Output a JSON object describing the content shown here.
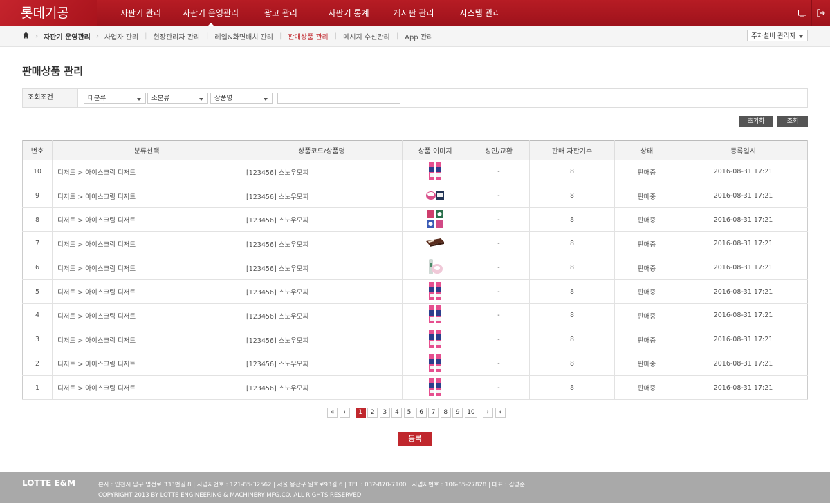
{
  "brand": "롯데기공",
  "nav": [
    "자판기 관리",
    "자판기 운영관리",
    "광고 관리",
    "자판기 통계",
    "게시판 관리",
    "시스템 관리"
  ],
  "breadcrumb": {
    "section": "자판기 운영관리",
    "items": [
      "사업자 관리",
      "현장관리자 관리",
      "레일&화면배치 관리",
      "판매상품 관리",
      "메시지 수신관리",
      "App 관리"
    ],
    "current_index": 3
  },
  "role_select": "주차설비 관리자",
  "page_title": "판매상품 관리",
  "filter": {
    "label": "조회조건",
    "category_major": "대분류",
    "category_minor": "소분류",
    "product_name": "상품명",
    "keyword": ""
  },
  "buttons": {
    "reset": "초기화",
    "search": "조회",
    "register": "등록"
  },
  "table": {
    "headers": [
      "번호",
      "분류선택",
      "상품코드/상품명",
      "상품 이미지",
      "성인/교환",
      "판매 자판기수",
      "상태",
      "등록일시"
    ],
    "rows": [
      {
        "no": "10",
        "category": "디저트 > 아이스크림 디저트",
        "product": "[123456] 스노우모찌",
        "img": "tall",
        "adult": "-",
        "count": "8",
        "status": "판매중",
        "date": "2016-08-31 17:21"
      },
      {
        "no": "9",
        "category": "디저트 > 아이스크림 디저트",
        "product": "[123456] 스노우모찌",
        "img": "cups",
        "adult": "-",
        "count": "8",
        "status": "판매중",
        "date": "2016-08-31 17:21"
      },
      {
        "no": "8",
        "category": "디저트 > 아이스크림 디저트",
        "product": "[123456] 스노우모찌",
        "img": "boxes",
        "adult": "-",
        "count": "8",
        "status": "판매중",
        "date": "2016-08-31 17:21"
      },
      {
        "no": "7",
        "category": "디저트 > 아이스크림 디저트",
        "product": "[123456] 스노우모찌",
        "img": "bar",
        "adult": "-",
        "count": "8",
        "status": "판매중",
        "date": "2016-08-31 17:21"
      },
      {
        "no": "6",
        "category": "디저트 > 아이스크림 디저트",
        "product": "[123456] 스노우모찌",
        "img": "bottle",
        "adult": "-",
        "count": "8",
        "status": "판매중",
        "date": "2016-08-31 17:21"
      },
      {
        "no": "5",
        "category": "디저트 > 아이스크림 디저트",
        "product": "[123456] 스노우모찌",
        "img": "tall",
        "adult": "-",
        "count": "8",
        "status": "판매중",
        "date": "2016-08-31 17:21"
      },
      {
        "no": "4",
        "category": "디저트 > 아이스크림 디저트",
        "product": "[123456] 스노우모찌",
        "img": "tall",
        "adult": "-",
        "count": "8",
        "status": "판매중",
        "date": "2016-08-31 17:21"
      },
      {
        "no": "3",
        "category": "디저트 > 아이스크림 디저트",
        "product": "[123456] 스노우모찌",
        "img": "tall",
        "adult": "-",
        "count": "8",
        "status": "판매중",
        "date": "2016-08-31 17:21"
      },
      {
        "no": "2",
        "category": "디저트 > 아이스크림 디저트",
        "product": "[123456] 스노우모찌",
        "img": "tall",
        "adult": "-",
        "count": "8",
        "status": "판매중",
        "date": "2016-08-31 17:21"
      },
      {
        "no": "1",
        "category": "디저트 > 아이스크림 디저트",
        "product": "[123456] 스노우모찌",
        "img": "tall",
        "adult": "-",
        "count": "8",
        "status": "판매중",
        "date": "2016-08-31 17:21"
      }
    ]
  },
  "pagination": {
    "pages": [
      "1",
      "2",
      "3",
      "4",
      "5",
      "6",
      "7",
      "8",
      "9",
      "10"
    ],
    "current": "1",
    "first": "«",
    "prev": "‹",
    "next": "›",
    "last": "»"
  },
  "footer": {
    "logo": "LOTTE E&M",
    "address": "본사 : 인천시 남구 염전로 333번길 8 | 사업자번호 : 121-85-32562 | 서울 용산구 원효로93길 6 | TEL : 032-870-7100 | 사업자번호 : 106-85-27828 | 대표 : 김영순",
    "copyright": "COPYRIGHT 2013 BY LOTTE ENGINEERING & MACHINERY MFG.CO. ALL RIGHTS RESERVED"
  },
  "colors": {
    "primary": "#b71c24",
    "accent": "#c0272d",
    "footer": "#a9a9a9",
    "button_dark": "#555555"
  },
  "icons": [
    "home-icon",
    "monitor-icon",
    "logout-icon",
    "chevron-down-icon"
  ]
}
